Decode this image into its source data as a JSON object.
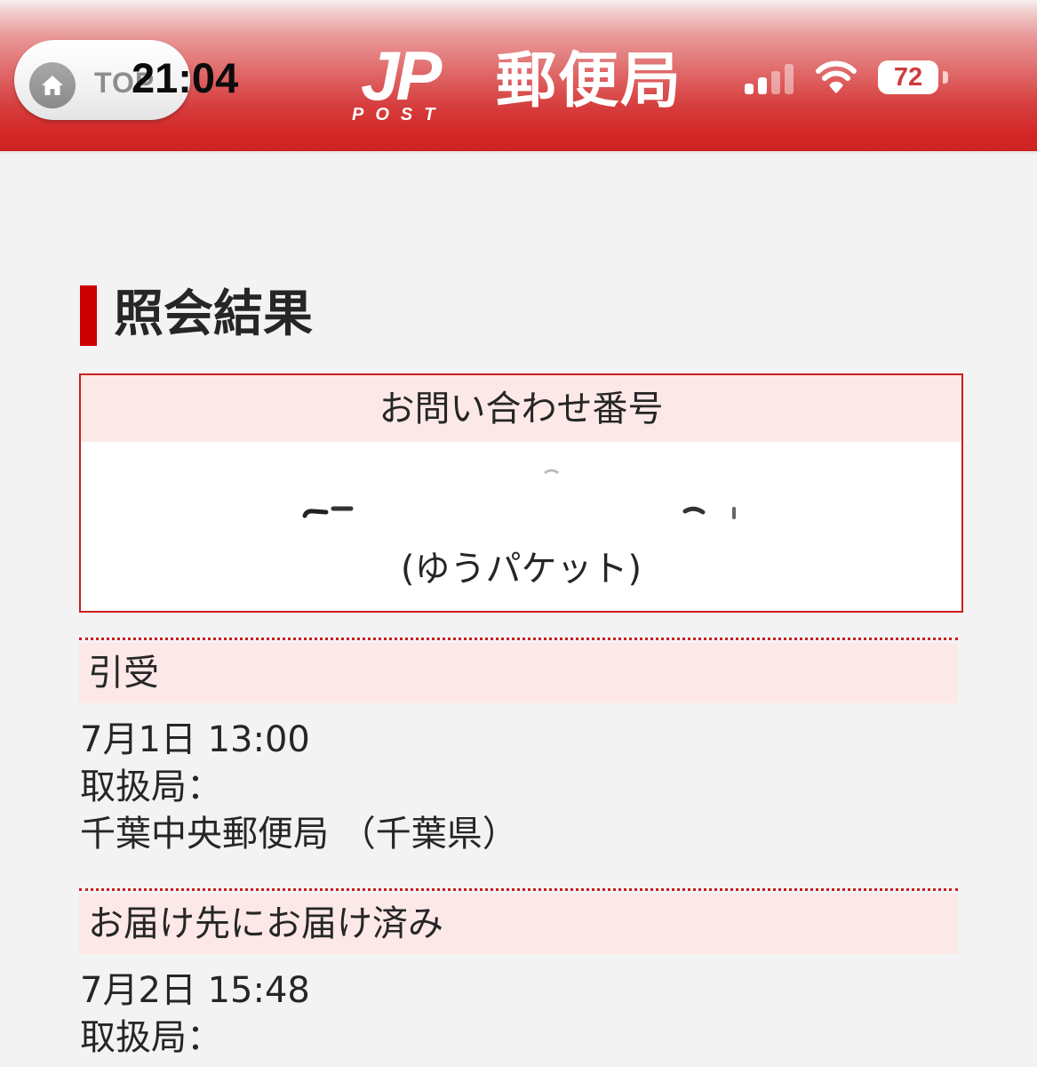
{
  "header": {
    "top_button_label": "TOP",
    "home_icon": "home-icon",
    "logo_mark": "JP",
    "logo_sub": "POST",
    "logo_name": "郵便局",
    "brand_color": "#cf2424"
  },
  "status_bar": {
    "time": "21:04",
    "signal_icon": "cellular-signal-icon",
    "wifi_icon": "wifi-icon",
    "battery_level": "72"
  },
  "result": {
    "title": "照会結果",
    "inquiry_header": "お問い合わせ番号",
    "inquiry_type": "(ゆうパケット)"
  },
  "events": [
    {
      "status": "引受",
      "datetime": "7月1日 13:00",
      "office_label": "取扱局：",
      "office": "千葉中央郵便局 （千葉県）"
    },
    {
      "status": "お届け先にお届け済み",
      "datetime": "7月2日 15:48",
      "office_label": "取扱局："
    }
  ]
}
